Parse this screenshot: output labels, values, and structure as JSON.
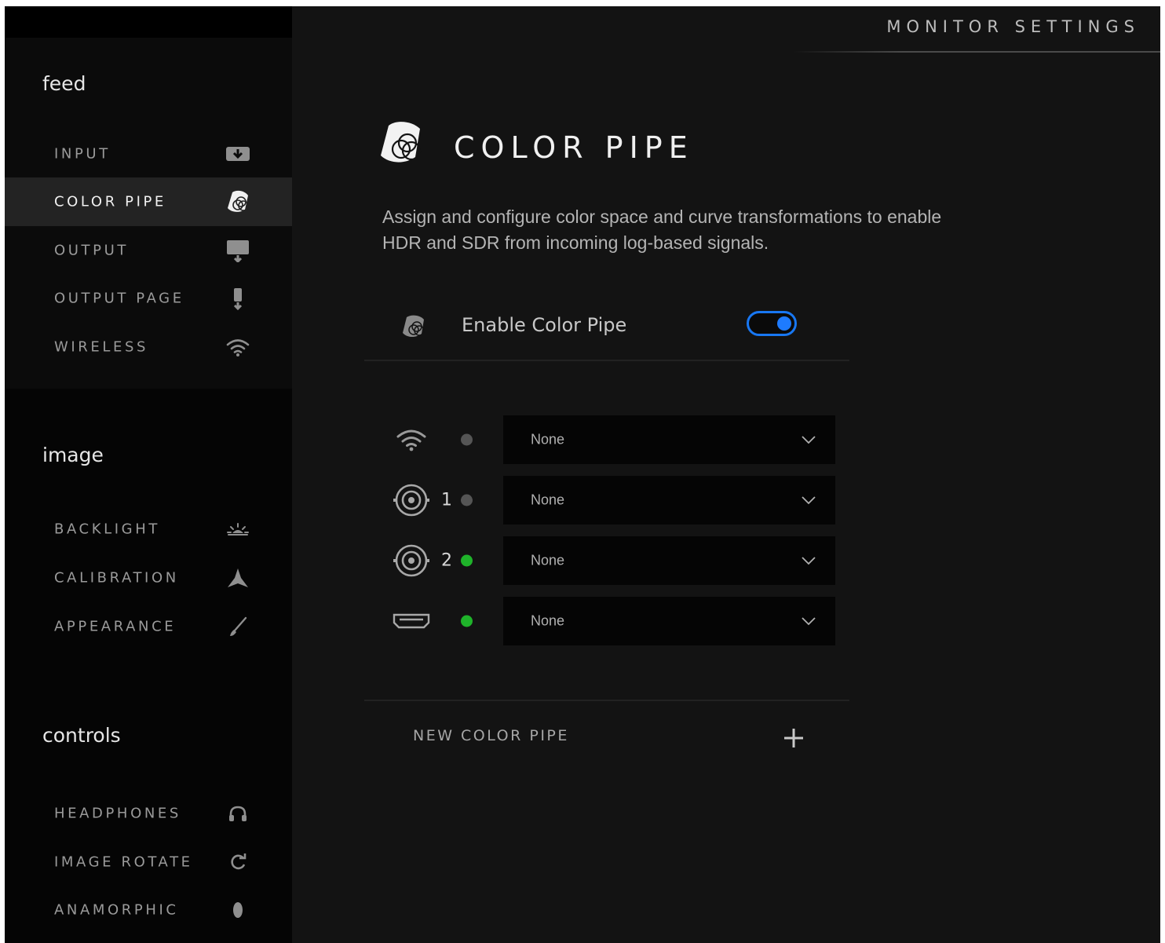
{
  "header": {
    "title": "MONITOR SETTINGS"
  },
  "sidebar": {
    "sections": [
      {
        "title": "feed",
        "items": [
          {
            "label": "INPUT",
            "icon": "input-icon",
            "active": false
          },
          {
            "label": "COLOR PIPE",
            "icon": "color-pipe-icon",
            "active": true
          },
          {
            "label": "OUTPUT",
            "icon": "output-monitor-icon",
            "active": false
          },
          {
            "label": "OUTPUT PAGE",
            "icon": "output-page-icon",
            "active": false
          },
          {
            "label": "WIRELESS",
            "icon": "wifi-icon",
            "active": false
          }
        ]
      },
      {
        "title": "image",
        "items": [
          {
            "label": "BACKLIGHT",
            "icon": "backlight-icon",
            "active": false
          },
          {
            "label": "CALIBRATION",
            "icon": "calibration-icon",
            "active": false
          },
          {
            "label": "APPEARANCE",
            "icon": "brush-icon",
            "active": false
          }
        ]
      },
      {
        "title": "controls",
        "items": [
          {
            "label": "HEADPHONES",
            "icon": "headphones-icon",
            "active": false
          },
          {
            "label": "IMAGE ROTATE",
            "icon": "rotate-icon",
            "active": false
          },
          {
            "label": "ANAMORPHIC",
            "icon": "anamorphic-icon",
            "active": false
          }
        ]
      }
    ]
  },
  "main": {
    "title": "COLOR PIPE",
    "description": "Assign and configure color space and curve transformations to enable HDR and SDR from incoming log-based signals.",
    "enable": {
      "label": "Enable Color Pipe",
      "on": true
    },
    "inputs": [
      {
        "icon": "wifi-icon",
        "number": "",
        "status": "inactive",
        "value": "None"
      },
      {
        "icon": "sdi-connector-icon",
        "number": "1",
        "status": "inactive",
        "value": "None"
      },
      {
        "icon": "sdi-connector-icon",
        "number": "2",
        "status": "active",
        "value": "None"
      },
      {
        "icon": "hdmi-icon",
        "number": "",
        "status": "active",
        "value": "None"
      }
    ],
    "new_pipe_label": "NEW COLOR PIPE"
  },
  "colors": {
    "accent": "#1877f2",
    "status_active": "#1fb32a",
    "status_inactive": "#555555",
    "background": "#131313"
  }
}
